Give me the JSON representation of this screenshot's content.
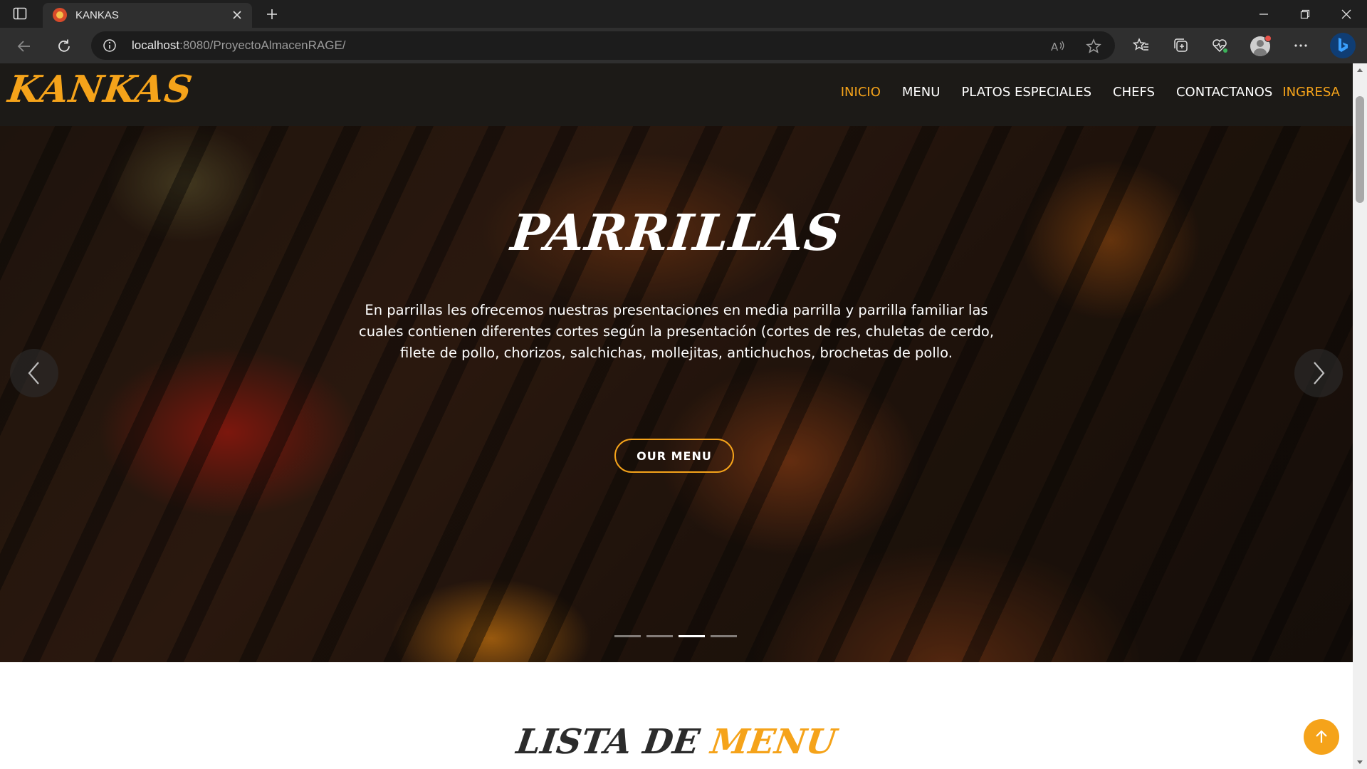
{
  "browser": {
    "tab": {
      "title": "KANKAS",
      "favicon": "kankas-favicon"
    },
    "url": {
      "host": "localhost",
      "rest": ":8080/ProyectoAlmacenRAGE/"
    },
    "icons": [
      "tab-actions-icon",
      "close-icon",
      "plus-icon",
      "minimize-icon",
      "restore-icon",
      "window-close-icon",
      "back-icon",
      "refresh-icon",
      "info-icon",
      "read-aloud-icon",
      "star-icon",
      "favorites-icon",
      "collections-icon",
      "health-icon",
      "profile-icon",
      "more-icon",
      "copilot-icon"
    ]
  },
  "site": {
    "logo": "KANKAS",
    "nav": [
      {
        "label": "INICIO",
        "active": true
      },
      {
        "label": "MENU",
        "active": false
      },
      {
        "label": "PLATOS ESPECIALES",
        "active": false
      },
      {
        "label": "CHEFS",
        "active": false
      },
      {
        "label": "CONTACTANOS",
        "active": false
      },
      {
        "label": "INGRESA",
        "active": false
      }
    ],
    "accent_color": "#f5a31a",
    "header_color": "#1c1a17"
  },
  "hero": {
    "title": "PARRILLAS",
    "text": "En parrillas les ofrecemos nuestras presentaciones en media parrilla y parrilla familiar las cuales contienen diferentes cortes según la presentación (cortes de res, chuletas de cerdo, filete de pollo, chorizos, salchichas, mollejitas, antichuchos, brochetas de pollo.",
    "button_label": "OUR MENU",
    "slides_total": 4,
    "active_slide": 3
  },
  "section": {
    "heading_part1": "LISTA DE ",
    "heading_part2": "MENU"
  }
}
